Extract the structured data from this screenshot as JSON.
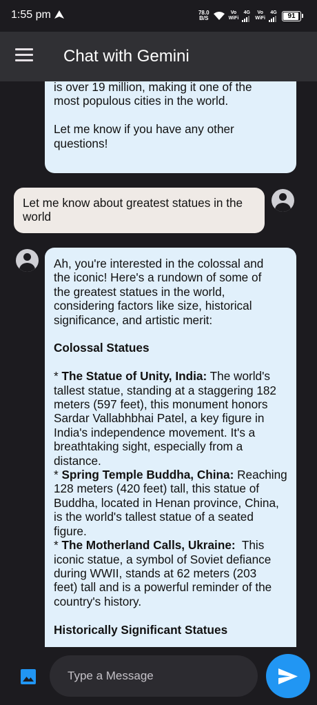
{
  "status_bar": {
    "time": "1:55 pm",
    "net_speed_value": "78.0",
    "net_speed_unit": "B/S",
    "sim1_volte_top": "Vo",
    "sim1_volte_bottom": "WiFi",
    "sim1_network": "4G",
    "sim2_volte_top": "Vo",
    "sim2_volte_bottom": "WiFi",
    "sim2_network": "4G",
    "battery": "91",
    "battery_level": 0.91
  },
  "app_bar": {
    "title": "Chat with Gemini",
    "menu_icon": "hamburger-menu-icon"
  },
  "messages": [
    {
      "role": "bot",
      "lines": [
        "is over 19 million, making it one of the",
        "most populous cities in the world.",
        "",
        "Let me know if you have any other",
        "questions!"
      ]
    },
    {
      "role": "user",
      "lines": [
        "Let me know about greatest statues in the",
        "world"
      ]
    },
    {
      "role": "bot",
      "intro": [
        "Ah, you're interested in the colossal and",
        "the iconic! Here's a rundown of some of",
        "the greatest statues in the world,",
        "considering factors like size, historical",
        "significance, and artistic merit:"
      ],
      "section1_heading": "Colossal Statues",
      "items": [
        {
          "bullet": "* ",
          "name": "The Statue of Unity, India:",
          "first_line_rest": " The world's",
          "lines": [
            "tallest statue, standing at a staggering 182",
            "meters (597 feet), this monument honors",
            "Sardar Vallabhbhai Patel, a key figure in",
            "India's independence movement. It's a",
            "breathtaking sight, especially from a",
            "distance."
          ]
        },
        {
          "bullet": "* ",
          "name": "Spring Temple Buddha, China:",
          "first_line_rest": " Reaching",
          "lines": [
            "128 meters (420 feet) tall, this statue of",
            "Buddha, located in Henan province, China,",
            "is the world's tallest statue of a seated",
            "figure."
          ]
        },
        {
          "bullet": "* ",
          "name": "The Motherland Calls, Ukraine:",
          "first_line_rest": "  This",
          "lines": [
            "iconic statue, a symbol of Soviet defiance",
            "during WWII, stands at 62 meters (203",
            "feet) tall and is a powerful reminder of the",
            "country's history."
          ]
        }
      ],
      "section2_heading": "Historically Significant Statues"
    }
  ],
  "input": {
    "placeholder": "Type a Message",
    "value": ""
  },
  "icons": {
    "image": "image-icon",
    "send": "send-icon",
    "avatar": "person-avatar-icon"
  },
  "colors": {
    "background": "#1c1b1f",
    "app_bar": "#303034",
    "bot_bubble": "#e1f0fb",
    "user_bubble": "#efeae6",
    "send_button": "#2196f3",
    "image_icon": "#2196f3"
  }
}
